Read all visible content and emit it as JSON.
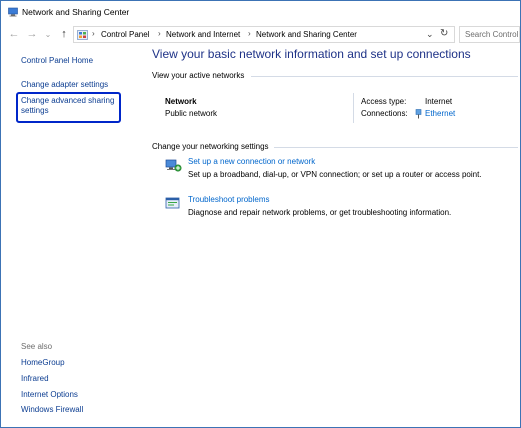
{
  "window": {
    "title": "Network and Sharing Center"
  },
  "address": {
    "breadcrumbs": [
      "Control Panel",
      "Network and Internet",
      "Network and Sharing Center"
    ],
    "search_placeholder": "Search Control Panel"
  },
  "sidebar": {
    "links": [
      {
        "label": "Control Panel Home"
      },
      {
        "label": "Change adapter settings"
      },
      {
        "label": "Change advanced sharing settings"
      }
    ],
    "see_also_label": "See also",
    "see_also": [
      {
        "label": "HomeGroup"
      },
      {
        "label": "Infrared"
      },
      {
        "label": "Internet Options"
      },
      {
        "label": "Windows Firewall"
      }
    ]
  },
  "main": {
    "heading": "View your basic network information and set up connections",
    "active_networks_label": "View your active networks",
    "network": {
      "name": "Network",
      "category": "Public network",
      "access_type_label": "Access type:",
      "access_type_value": "Internet",
      "connections_label": "Connections:",
      "connections_value": "Ethernet"
    },
    "change_settings_label": "Change your networking settings",
    "tasks": [
      {
        "icon": "network-setup-icon",
        "title": "Set up a new connection or network",
        "description": "Set up a broadband, dial-up, or VPN connection; or set up a router or access point."
      },
      {
        "icon": "troubleshoot-icon",
        "title": "Troubleshoot problems",
        "description": "Diagnose and repair network problems, or get troubleshooting information."
      }
    ]
  },
  "colors": {
    "heading": "#1e3287",
    "link": "#0066cc",
    "highlight_border": "#0026c9",
    "window_border": "#3c73b5"
  }
}
